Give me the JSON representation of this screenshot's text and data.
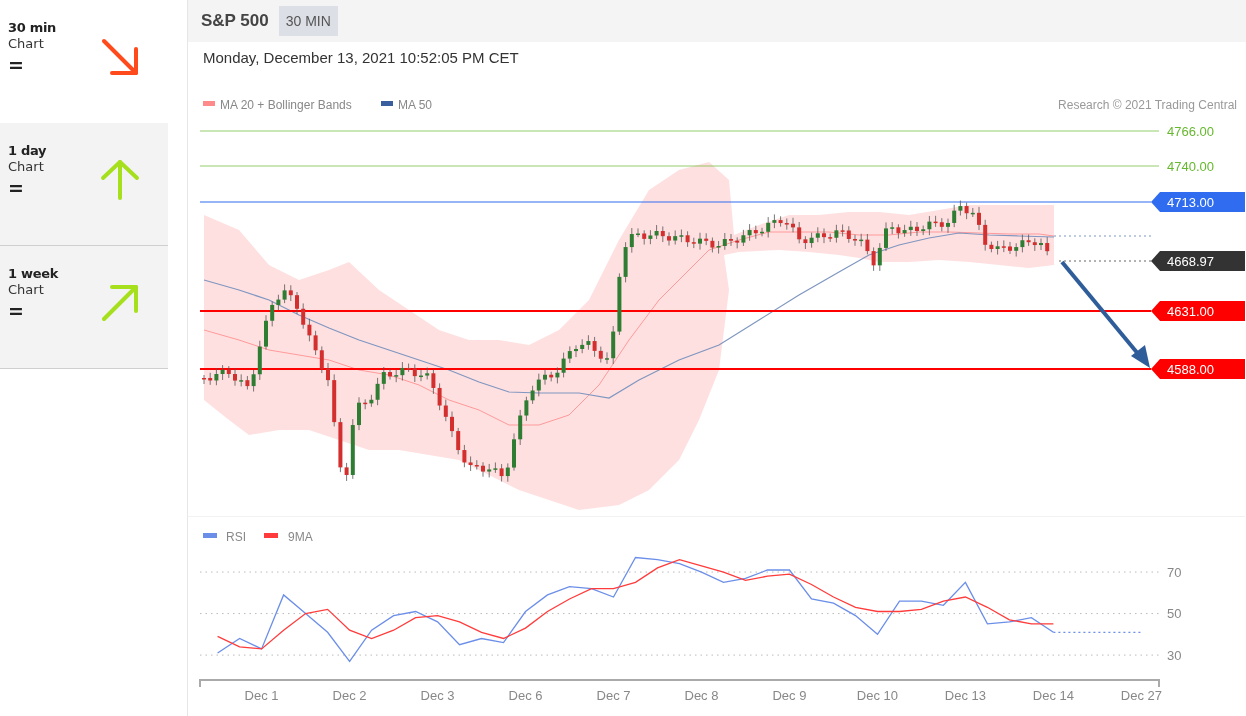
{
  "sidebar": {
    "items": [
      {
        "title": "30 min",
        "subtitle": "Chart",
        "signal": "=",
        "kind": "down-right",
        "color": "#ff4a1c",
        "selected": true
      },
      {
        "title": "1 day",
        "subtitle": "Chart",
        "signal": "=",
        "kind": "up",
        "color": "#a6e01c",
        "selected": false
      },
      {
        "title": "1 week",
        "subtitle": "Chart",
        "signal": "=",
        "kind": "up-right",
        "color": "#a6e01c",
        "selected": false
      }
    ]
  },
  "header": {
    "symbol": "S&P 500",
    "timeframe": "30 MIN"
  },
  "timestamp": "Monday, December 13, 2021 10:52:05 PM CET",
  "price_chart": {
    "legend": [
      {
        "label": "MA 20 + Bollinger Bands",
        "color": "#ff8a8a"
      },
      {
        "label": "MA 50",
        "color": "#3a5f9e"
      }
    ],
    "credit": "Research © 2021 Trading Central",
    "levels": [
      {
        "kind": "plain",
        "label": "4766.00",
        "color": "#66b82e"
      },
      {
        "kind": "plain",
        "label": "4740.00",
        "color": "#66b82e"
      },
      {
        "kind": "tag",
        "label": "4713.00",
        "color": "#2f6cf0"
      },
      {
        "kind": "price",
        "label": "4668.97",
        "color": "#333333"
      },
      {
        "kind": "tag",
        "label": "4631.00",
        "color": "#ff0000"
      },
      {
        "kind": "tag",
        "label": "4588.00",
        "color": "#ff0000"
      }
    ]
  },
  "rsi_panel": {
    "chart_data": {
      "type": "line",
      "categories": [
        null,
        null,
        "Dec 1",
        null,
        null,
        null,
        "Dec 2",
        null,
        null,
        null,
        "Dec 3",
        null,
        null,
        null,
        "Dec 6",
        null,
        null,
        null,
        "Dec 7",
        null,
        null,
        null,
        "Dec 8",
        null,
        null,
        null,
        "Dec 9",
        null,
        null,
        null,
        "Dec 10",
        null,
        null,
        null,
        "Dec 13",
        null,
        null,
        null,
        "Dec 14",
        null,
        null,
        null,
        "Dec 27"
      ],
      "series": [
        {
          "name": "RSI",
          "color": "#6b8ee8",
          "values": [
            31,
            38,
            33,
            59,
            50,
            41,
            27,
            42,
            49,
            51,
            46,
            35,
            38,
            36,
            51,
            59,
            63,
            62,
            58,
            77,
            76,
            74,
            70,
            65,
            67,
            71,
            71,
            57,
            55,
            49,
            40,
            56,
            56,
            54,
            65,
            45,
            46,
            48,
            41,
            41,
            41,
            41,
            41
          ]
        },
        {
          "name": "9MA",
          "color": "#ff3b3b",
          "values": [
            39,
            34,
            33,
            42,
            50,
            52,
            42,
            38,
            42,
            48,
            49,
            46,
            41,
            38,
            43,
            51,
            57,
            62,
            62,
            65,
            72,
            76,
            73,
            70,
            66,
            68,
            69,
            64,
            58,
            53,
            51,
            51,
            52,
            56,
            58,
            53,
            47,
            45,
            45,
            null,
            null,
            null,
            null
          ]
        }
      ],
      "ylim": [
        18,
        97
      ],
      "yticks": [
        30,
        50,
        70
      ],
      "grid": true,
      "legend": "top-left"
    }
  }
}
